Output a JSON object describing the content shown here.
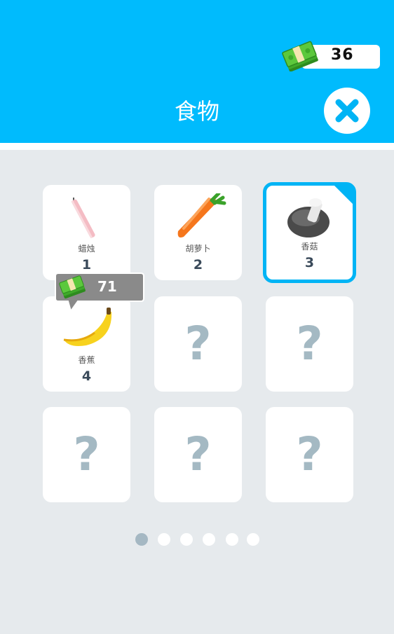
{
  "header": {
    "title": "食物",
    "currency_amount": "36",
    "currency_icon": "cash-stack-icon",
    "close_icon": "close-x-icon",
    "background_color": "#00bbfd"
  },
  "grid": {
    "items": [
      {
        "name": "蜡烛",
        "number": "1",
        "icon": "candle-icon",
        "unlocked": true
      },
      {
        "name": "胡萝卜",
        "number": "2",
        "icon": "carrot-icon",
        "unlocked": true
      },
      {
        "name": "香菇",
        "number": "3",
        "icon": "mushroom-icon",
        "unlocked": true,
        "selected": true
      },
      {
        "name": "香蕉",
        "number": "4",
        "icon": "banana-icon",
        "unlocked": true
      },
      {
        "locked_text": "?",
        "unlocked": false
      },
      {
        "locked_text": "?",
        "unlocked": false
      },
      {
        "locked_text": "?",
        "unlocked": false
      },
      {
        "locked_text": "?",
        "unlocked": false
      },
      {
        "locked_text": "?",
        "unlocked": false
      }
    ]
  },
  "price_tag": {
    "amount": "71",
    "icon": "cash-stack-icon"
  },
  "pagination": {
    "page_count": 6,
    "current_page": 1
  },
  "colors": {
    "accent": "#00b4f5",
    "locked_glyph": "#a4b9c3",
    "background": "#e6eaed"
  }
}
